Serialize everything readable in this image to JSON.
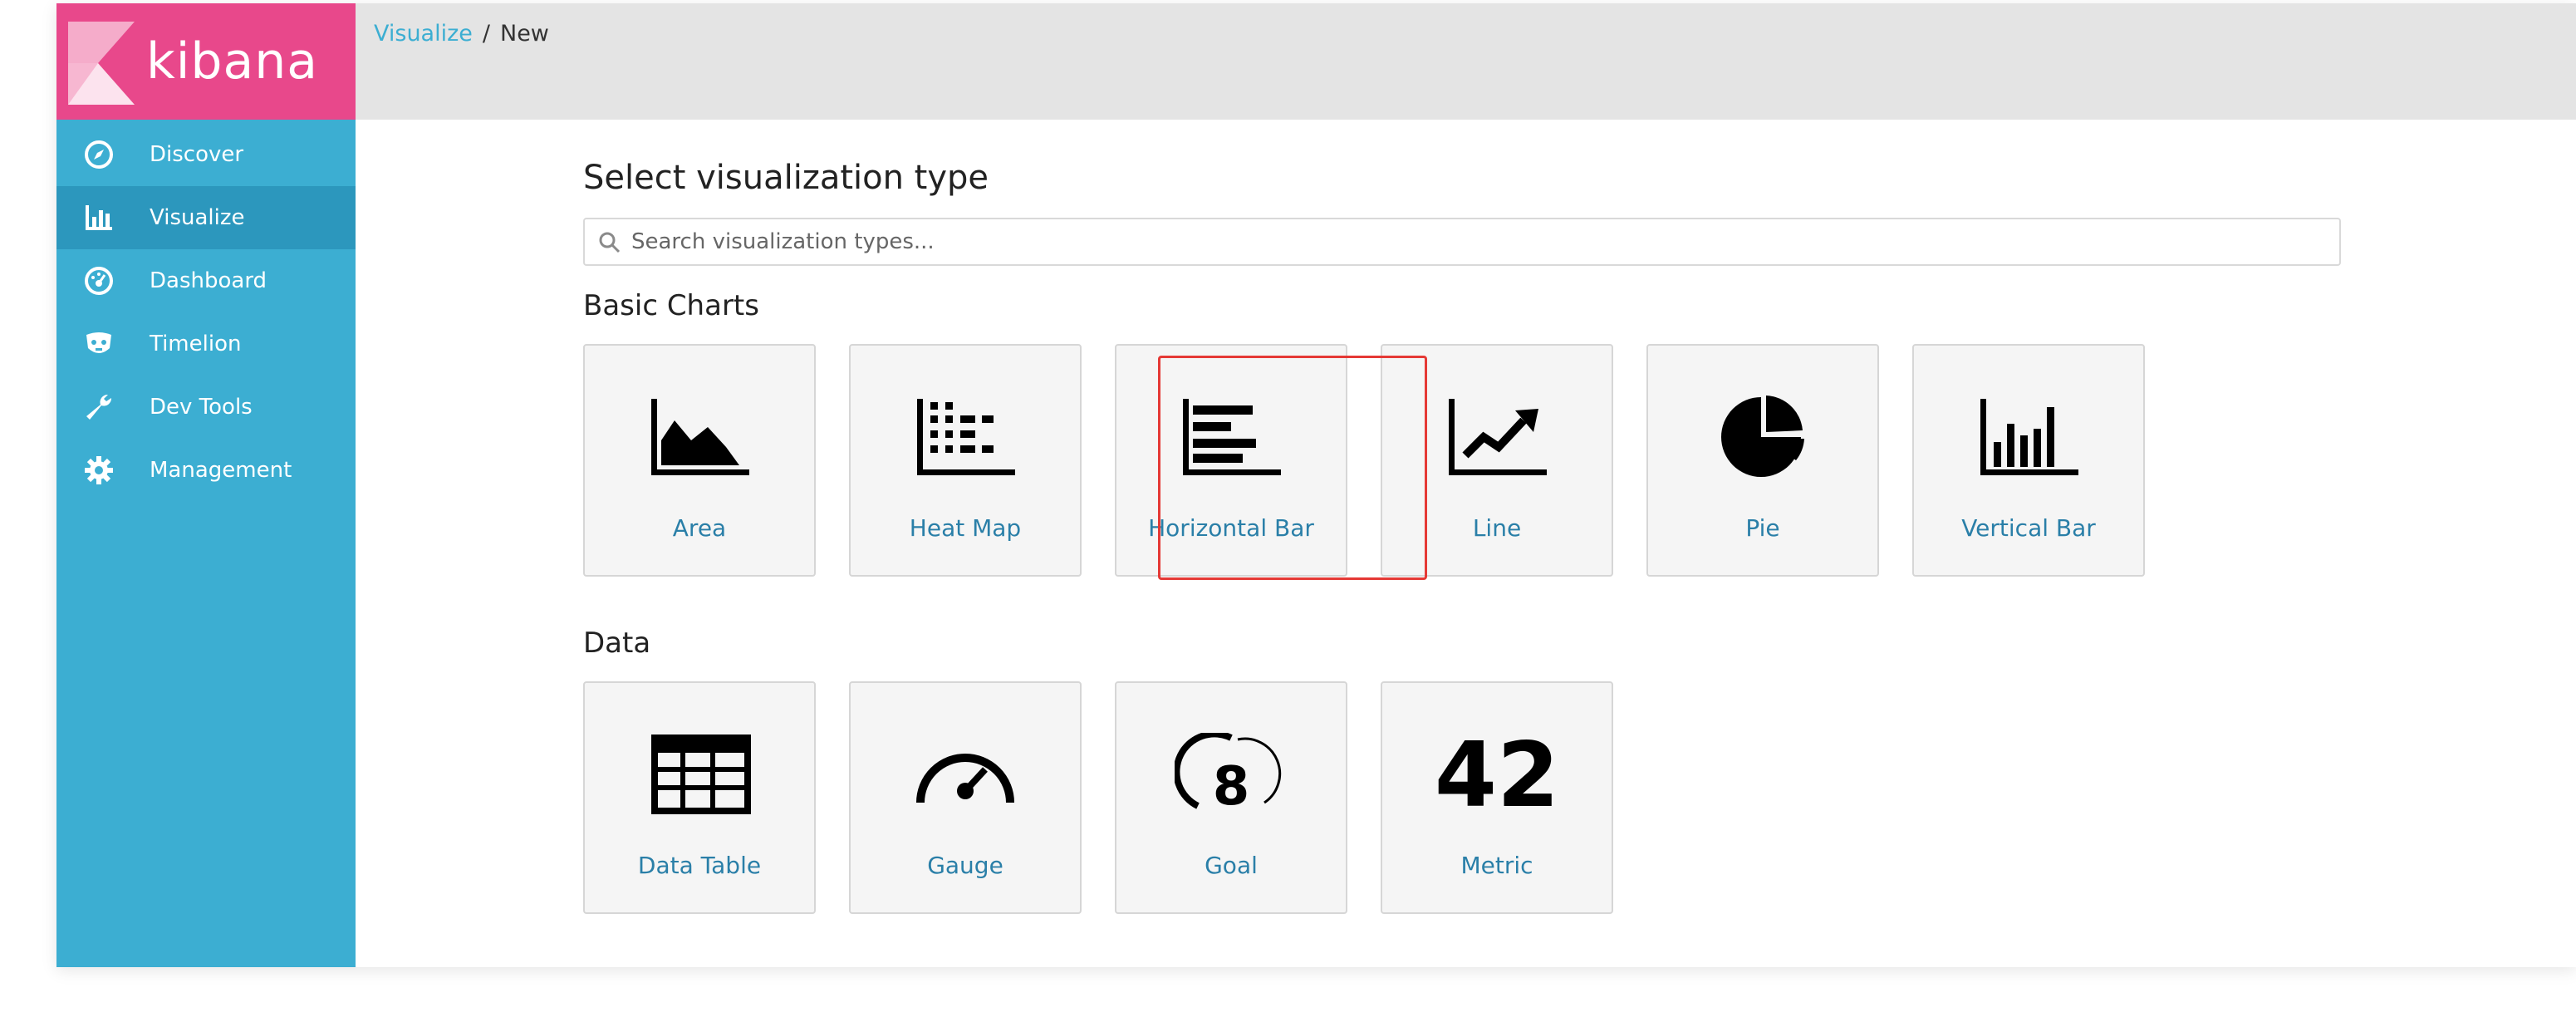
{
  "app": {
    "logo_text": "kibana",
    "brand_color": "#e8488b",
    "sidebar_color": "#3caed2",
    "active_color": "#2c97bd"
  },
  "sidebar": {
    "items": [
      {
        "label": "Discover",
        "icon": "compass-icon",
        "active": false
      },
      {
        "label": "Visualize",
        "icon": "bar-chart-icon",
        "active": true
      },
      {
        "label": "Dashboard",
        "icon": "dashboard-gauge-icon",
        "active": false
      },
      {
        "label": "Timelion",
        "icon": "timelion-mask-icon",
        "active": false
      },
      {
        "label": "Dev Tools",
        "icon": "wrench-icon",
        "active": false
      },
      {
        "label": "Management",
        "icon": "gear-icon",
        "active": false
      }
    ]
  },
  "breadcrumb": {
    "link": "Visualize",
    "separator": "/",
    "current": "New"
  },
  "main": {
    "title": "Select visualization type",
    "search_placeholder": "Search visualization types...",
    "sections": [
      {
        "title": "Basic Charts",
        "tiles": [
          {
            "label": "Area",
            "icon": "area-chart-icon"
          },
          {
            "label": "Heat Map",
            "icon": "heat-map-icon"
          },
          {
            "label": "Horizontal Bar",
            "icon": "horizontal-bar-icon",
            "highlighted": true
          },
          {
            "label": "Line",
            "icon": "line-chart-icon"
          },
          {
            "label": "Pie",
            "icon": "pie-chart-icon"
          },
          {
            "label": "Vertical Bar",
            "icon": "vertical-bar-icon"
          }
        ]
      },
      {
        "title": "Data",
        "tiles": [
          {
            "label": "Data Table",
            "icon": "data-table-icon"
          },
          {
            "label": "Gauge",
            "icon": "gauge-icon"
          },
          {
            "label": "Goal",
            "icon": "goal-icon",
            "icon_text": "8"
          },
          {
            "label": "Metric",
            "icon": "metric-icon",
            "icon_text": "42"
          }
        ]
      }
    ]
  },
  "highlight_color": "#e53935"
}
